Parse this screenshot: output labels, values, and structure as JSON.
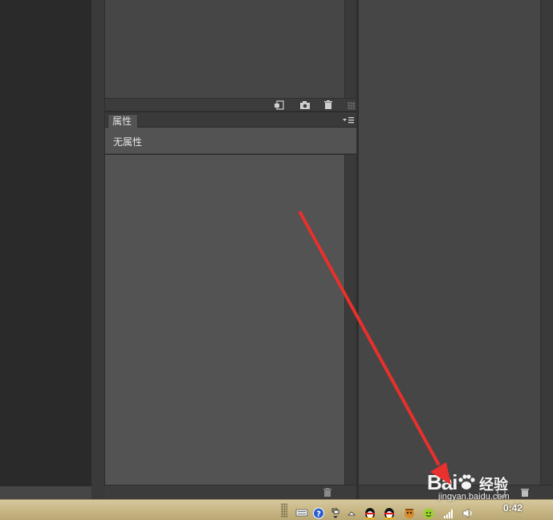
{
  "properties_panel": {
    "tab_label": "属性",
    "content_label": "无属性"
  },
  "icons": {
    "history_footer": [
      "new-document-from-state-icon",
      "camera-snapshot-icon",
      "trash-icon"
    ],
    "properties_footer": [
      "trash-icon"
    ],
    "panel_menu": "panel-menu-icon"
  },
  "taskbar": {
    "clock": "0:42"
  },
  "watermark": {
    "logo": "Bai",
    "logo_suffix": "du",
    "text": "经验",
    "url": "jingyan.baidu.com"
  },
  "colors": {
    "panel_bg": "#535353",
    "annotation_arrow": "#e8302c",
    "taskbar": "#c9b887"
  }
}
